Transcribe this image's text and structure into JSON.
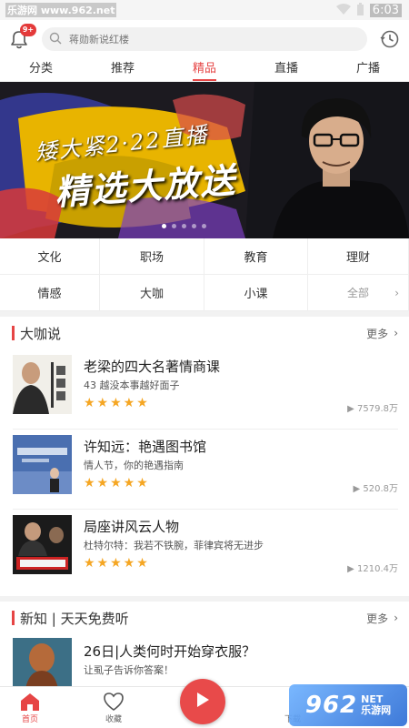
{
  "status": {
    "watermark": "乐游网 www.962.net",
    "time": "6:03"
  },
  "header": {
    "badge": "9+",
    "search_placeholder": "蒋勋新说红楼"
  },
  "tabs": [
    {
      "label": "分类"
    },
    {
      "label": "推荐"
    },
    {
      "label": "精品"
    },
    {
      "label": "直播"
    },
    {
      "label": "广播"
    }
  ],
  "banner": {
    "line1": "矮大紧2·22直播",
    "line2": "精选大放送"
  },
  "categories": [
    {
      "label": "文化"
    },
    {
      "label": "职场"
    },
    {
      "label": "教育"
    },
    {
      "label": "理财"
    },
    {
      "label": "情感"
    },
    {
      "label": "大咖"
    },
    {
      "label": "小课"
    },
    {
      "label": "全部"
    }
  ],
  "section1": {
    "title": "大咖说",
    "more": "更多",
    "items": [
      {
        "title": "老梁的四大名著情商课",
        "subtitle": "43 越没本事越好面子",
        "rating": 5,
        "plays": "7579.8万"
      },
      {
        "title": "许知远：艳遇图书馆",
        "subtitle": "情人节，你的艳遇指南",
        "rating": 5,
        "plays": "520.8万"
      },
      {
        "title": "局座讲风云人物",
        "subtitle": "杜特尔特：我若不铁腕，菲律宾将无进步",
        "rating": 5,
        "plays": "1210.4万"
      }
    ]
  },
  "section2": {
    "title": "新知 | 天天免费听",
    "more": "更多",
    "items": [
      {
        "title": "26日|人类何时开始穿衣服？",
        "subtitle": "让虱子告诉你答案！"
      }
    ]
  },
  "tabbar": {
    "home": "首页",
    "favorites": "收藏",
    "download": "下载"
  },
  "corner_watermark": {
    "big": "962",
    "small_top": "NET",
    "small_bottom": "乐游网"
  },
  "colors": {
    "accent": "#e64545",
    "star": "#f5a623"
  }
}
